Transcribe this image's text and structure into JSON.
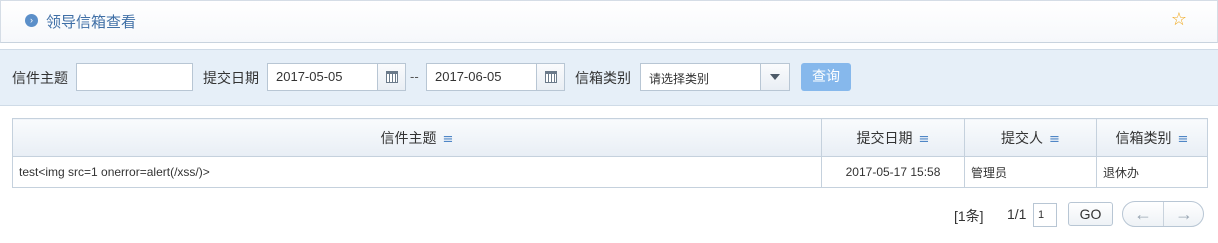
{
  "header": {
    "title": "领导信箱查看",
    "bullet_glyph": "›",
    "star_glyph": "☆"
  },
  "filters": {
    "subject_label": "信件主题",
    "subject_value": "",
    "date_label": "提交日期",
    "date_from": "2017-05-05",
    "date_separator": "--",
    "date_to": "2017-06-05",
    "category_label": "信箱类别",
    "category_value": "请选择类别",
    "search_button": "查询"
  },
  "table": {
    "sort_glyph": "≡",
    "columns": [
      "信件主题",
      "提交日期",
      "提交人",
      "信箱类别"
    ],
    "rows": [
      [
        "test<img src=1 onerror=alert(/xss/)>",
        "2017-05-17 15:58",
        "管理员",
        "退休办"
      ]
    ]
  },
  "pager": {
    "count_text": "[1条]",
    "pages_text": "1/1",
    "page_input": "1",
    "go_button": "GO",
    "prev_glyph": "←",
    "next_glyph": "→"
  },
  "colors": {
    "accent": "#3f6fa6",
    "search_button": "#86b8ec",
    "star": "#f0a81c",
    "filter_bg": "#e6eff8"
  }
}
